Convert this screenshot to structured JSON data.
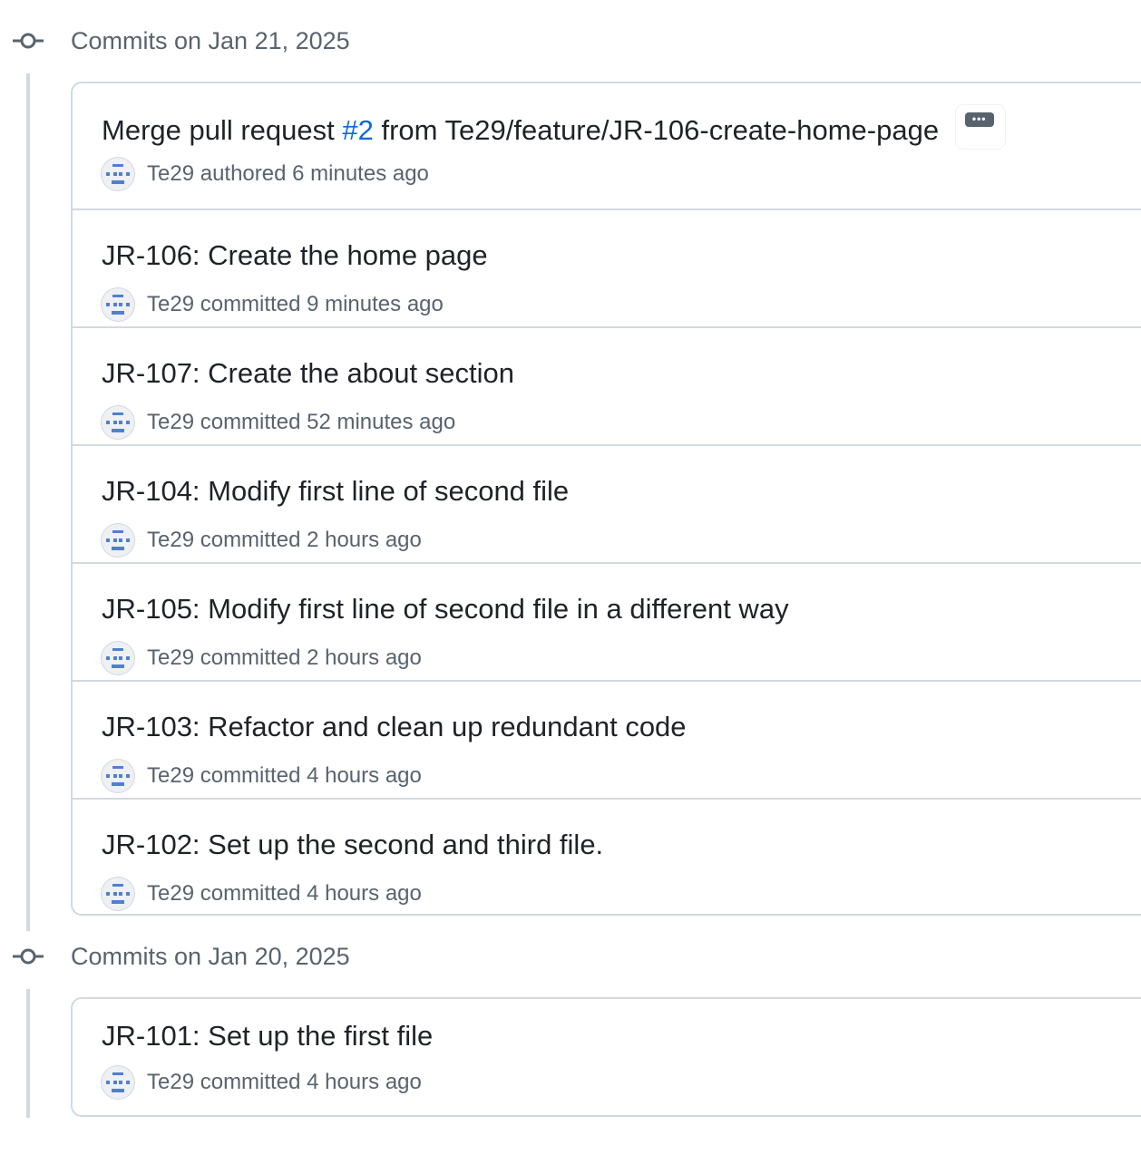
{
  "groups": [
    {
      "title": "Commits on Jan 21, 2025",
      "commits": [
        {
          "title_prefix": "Merge pull request ",
          "pr_number": "#2",
          "title_suffix": " from Te29/feature/JR-106-create-home-page",
          "author": "Te29",
          "action": "authored",
          "time": "6 minutes ago",
          "has_ellipsis": true
        },
        {
          "title": "JR-106: Create the home page",
          "author": "Te29",
          "action": "committed",
          "time": "9 minutes ago"
        },
        {
          "title": "JR-107: Create the about section",
          "author": "Te29",
          "action": "committed",
          "time": "52 minutes ago"
        },
        {
          "title": "JR-104: Modify first line of second file",
          "author": "Te29",
          "action": "committed",
          "time": "2 hours ago"
        },
        {
          "title": "JR-105: Modify first line of second file in a different way",
          "author": "Te29",
          "action": "committed",
          "time": "2 hours ago"
        },
        {
          "title": "JR-103: Refactor and clean up redundant code",
          "author": "Te29",
          "action": "committed",
          "time": "4 hours ago"
        },
        {
          "title": "JR-102: Set up the second and third file.",
          "author": "Te29",
          "action": "committed",
          "time": "4 hours ago"
        }
      ]
    },
    {
      "title": "Commits on Jan 20, 2025",
      "commits": [
        {
          "title": "JR-101: Set up the first file",
          "author": "Te29",
          "action": "committed",
          "time": "4 hours ago"
        }
      ]
    }
  ],
  "icons": {
    "group_icon": "git-commit-icon",
    "avatar_icon": "identicon-avatar",
    "ellipsis_icon": "ellipsis-icon"
  },
  "colors": {
    "link": "#0969da",
    "muted_text": "#59636e",
    "border": "#d1d9e0",
    "avatar_blue": "#4f7fd1"
  }
}
